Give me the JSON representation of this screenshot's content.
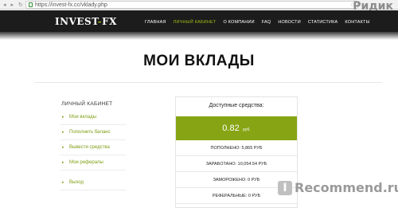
{
  "browser": {
    "url": "https://invest-fx.cc/vklady.php",
    "watermark_top": "Ридик"
  },
  "header": {
    "logo_main": "INVEST",
    "logo_dash": "-",
    "logo_fx": "FX",
    "menu": [
      {
        "label": "ГЛАВНАЯ"
      },
      {
        "label": "ЛИЧНЫЙ КАБИНЕТ"
      },
      {
        "label": "О КОМПАНИИ"
      },
      {
        "label": "FAQ"
      },
      {
        "label": "НОВОСТИ"
      },
      {
        "label": "СТАТИСТИКА"
      },
      {
        "label": "КОНТАКТЫ"
      }
    ],
    "active_index": 1
  },
  "page": {
    "title": "МОИ ВКЛАДЫ"
  },
  "sidebar": {
    "title": "ЛИЧНЫЙ КАБИНЕТ",
    "items": [
      {
        "label": "Мои вклады"
      },
      {
        "label": "Пополнить баланс"
      },
      {
        "label": "Вывести средства"
      },
      {
        "label": "Мои рефералы"
      },
      {
        "label": "Выход"
      }
    ]
  },
  "balance": {
    "heading": "Доступные средства:",
    "amount": "0.82",
    "currency": "руб.",
    "rows": [
      {
        "text": "ПОПОЛНЕНО: 5,865 РУБ"
      },
      {
        "text": "ЗАРАБОТАНО: 10,054.54 РУБ"
      },
      {
        "text": "ЗАМОРОЖЕНО: 0 РУБ"
      },
      {
        "text": "РЕФЕРАЛЬНЫЕ: 0 РУБ"
      }
    ]
  },
  "watermark": {
    "icon_letter": "I",
    "text": "Recommend.ru"
  },
  "colors": {
    "accent_green": "#87a414",
    "header_bg": "#1c1c1c"
  }
}
